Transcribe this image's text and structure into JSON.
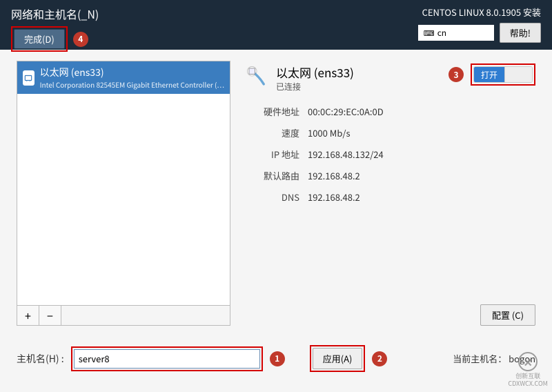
{
  "header": {
    "title": "网络和主机名(_N)",
    "subtitle": "CENTOS LINUX 8.0.1905 安装",
    "done_label": "完成(D)",
    "lang_code": "cn",
    "help_label": "帮助!"
  },
  "badges": {
    "one": "1",
    "two": "2",
    "three": "3",
    "four": "4"
  },
  "nic_list": {
    "item": {
      "name": "以太网 (ens33)",
      "sub": "Intel Corporation 82545EM Gigabit Ethernet Controller (…"
    },
    "add": "+",
    "remove": "−"
  },
  "detail": {
    "title": "以太网 (ens33)",
    "status": "已连接",
    "toggle_on": "打开",
    "props": {
      "hw_label": "硬件地址",
      "hw_value": "00:0C:29:EC:0A:0D",
      "speed_label": "速度",
      "speed_value": "1000 Mb/s",
      "ip_label": "IP 地址",
      "ip_value": "192.168.48.132/24",
      "gw_label": "默认路由",
      "gw_value": "192.168.48.2",
      "dns_label": "DNS",
      "dns_value": "192.168.48.2"
    },
    "configure_label": "配置 (C)"
  },
  "hostname": {
    "label": "主机名(H) :",
    "value": "server8",
    "apply_label": "应用(A)",
    "current_prefix": "当前主机名：",
    "current_value": "bogon"
  },
  "watermark": {
    "brand": "创新互联",
    "sub": "CDXWCX.COM"
  }
}
